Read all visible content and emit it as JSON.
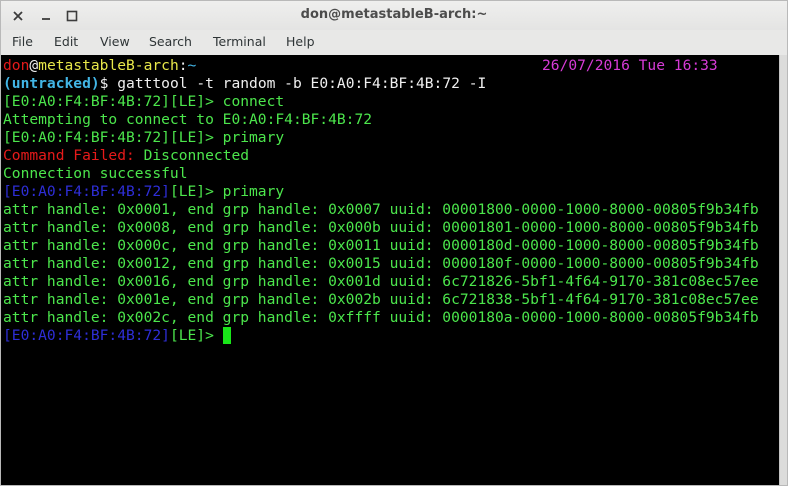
{
  "window": {
    "title": "don@metastableB-arch:~",
    "controls": {
      "close": "×",
      "minimize": "–",
      "maximize": "□"
    }
  },
  "menu": [
    "File",
    "Edit",
    "View",
    "Search",
    "Terminal",
    "Help"
  ],
  "terminal": {
    "prompt": {
      "user": "don",
      "at": "@",
      "host": "metastableB-arch",
      "colon": ":",
      "dir": "~",
      "datetime": "26/07/2016 Tue 16:33",
      "git_status": "(untracked)",
      "symbol": "$",
      "command": "gatttool -t random -b E0:A0:F4:BF:4B:72 -I"
    },
    "lines": {
      "l1_addr": "[E0:A0:F4:BF:4B:72][LE]>",
      "l1_cmd": " connect",
      "l2": "Attempting to connect to E0:A0:F4:BF:4B:72",
      "l3_addr": "[E0:A0:F4:BF:4B:72][LE]>",
      "l3_cmd": " primary",
      "l4_err": "Command Failed:",
      "l4_msg": " Disconnected",
      "l5": "Connection successful",
      "l6_addr": "[E0:A0:F4:BF:4B:72]",
      "l6_le": "[LE]>",
      "l6_cmd": " primary",
      "attrs": [
        "attr handle: 0x0001, end grp handle: 0x0007 uuid: 00001800-0000-1000-8000-00805f9b34fb",
        "attr handle: 0x0008, end grp handle: 0x000b uuid: 00001801-0000-1000-8000-00805f9b34fb",
        "attr handle: 0x000c, end grp handle: 0x0011 uuid: 0000180d-0000-1000-8000-00805f9b34fb",
        "attr handle: 0x0012, end grp handle: 0x0015 uuid: 0000180f-0000-1000-8000-00805f9b34fb",
        "attr handle: 0x0016, end grp handle: 0x001d uuid: 6c721826-5bf1-4f64-9170-381c08ec57ee",
        "attr handle: 0x001e, end grp handle: 0x002b uuid: 6c721838-5bf1-4f64-9170-381c08ec57ee",
        "attr handle: 0x002c, end grp handle: 0xffff uuid: 0000180a-0000-1000-8000-00805f9b34fb"
      ],
      "last_addr": "[E0:A0:F4:BF:4B:72]",
      "last_le": "[LE]> "
    }
  }
}
